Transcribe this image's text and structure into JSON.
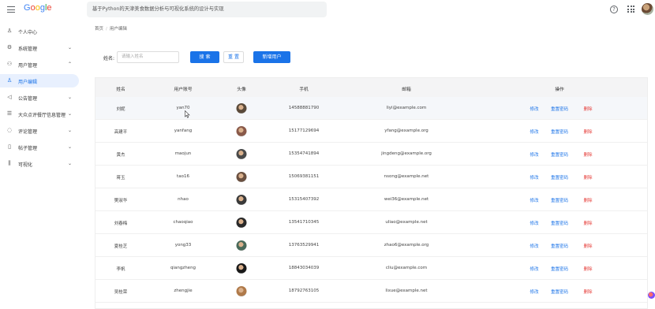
{
  "topbar": {
    "logo": "Google",
    "search_text": "基于Python的天津美食数据分析与可视化系统的设计与实现"
  },
  "colors": {
    "accent": "#1a73e8",
    "danger": "#e53935",
    "active_bg": "#e8f0fe"
  },
  "sidebar": {
    "items": [
      {
        "label": "个人中心",
        "icon": "person-icon",
        "chevron": ""
      },
      {
        "label": "系统管理",
        "icon": "gear-icon",
        "chevron": "⌄"
      },
      {
        "label": "用户管理",
        "icon": "users-icon",
        "chevron": "⌃"
      },
      {
        "label": "用户编辑",
        "icon": "person-icon",
        "chevron": ""
      },
      {
        "label": "公告管理",
        "icon": "megaphone-icon",
        "chevron": "⌄"
      },
      {
        "label": "大众点评餐厅信息管理",
        "icon": "list-icon",
        "chevron": "⌄"
      },
      {
        "label": "评论管理",
        "icon": "comment-icon",
        "chevron": "⌄"
      },
      {
        "label": "帖子管理",
        "icon": "document-icon",
        "chevron": "⌄"
      },
      {
        "label": "可视化",
        "icon": "chart-icon",
        "chevron": "⌄"
      }
    ]
  },
  "breadcrumb": {
    "home": "首页",
    "sep": "/",
    "current": "用户编辑"
  },
  "filter": {
    "name_label": "姓名:",
    "name_placeholder": "请输入姓名",
    "search_btn": "搜 索",
    "reset_btn": "重 置",
    "add_btn": "新增用户"
  },
  "table": {
    "headers": {
      "name": "姓名",
      "account": "用户账号",
      "avatar": "头像",
      "phone": "手机",
      "email": "邮箱",
      "ops": "操作"
    },
    "ops": {
      "edit": "修改",
      "reset": "重置密码",
      "delete": "删除"
    },
    "rows": [
      {
        "name": "刘妮",
        "account": "yan70",
        "phone": "14588881790",
        "email": "liyi@example.com",
        "avatar_color": "#5a4a3a"
      },
      {
        "name": "高建平",
        "account": "yanfang",
        "phone": "15177129694",
        "email": "yfang@example.org",
        "avatar_color": "#8a5a4a"
      },
      {
        "name": "黄杰",
        "account": "maojun",
        "phone": "15354741894",
        "email": "jingdeng@example.org",
        "avatar_color": "#4a4a4a"
      },
      {
        "name": "蒋玉",
        "account": "tao16",
        "phone": "15069381151",
        "email": "nsong@example.net",
        "avatar_color": "#6a5040"
      },
      {
        "name": "樊淑华",
        "account": "nhao",
        "phone": "15315407392",
        "email": "wei36@example.net",
        "avatar_color": "#3a3a3a"
      },
      {
        "name": "刘春梅",
        "account": "chaoqiao",
        "phone": "13541710345",
        "email": "uliao@example.net",
        "avatar_color": "#2a2a2a"
      },
      {
        "name": "夏桂芝",
        "account": "yong33",
        "phone": "13763529941",
        "email": "zhao6@example.org",
        "avatar_color": "#4a6a5a"
      },
      {
        "name": "李帆",
        "account": "qiangzheng",
        "phone": "18843034039",
        "email": "cliu@example.com",
        "avatar_color": "#1a1a1a"
      },
      {
        "name": "吴桂荣",
        "account": "zhengjie",
        "phone": "18792763105",
        "email": "lixue@example.net",
        "avatar_color": "#b07a4a"
      }
    ]
  }
}
